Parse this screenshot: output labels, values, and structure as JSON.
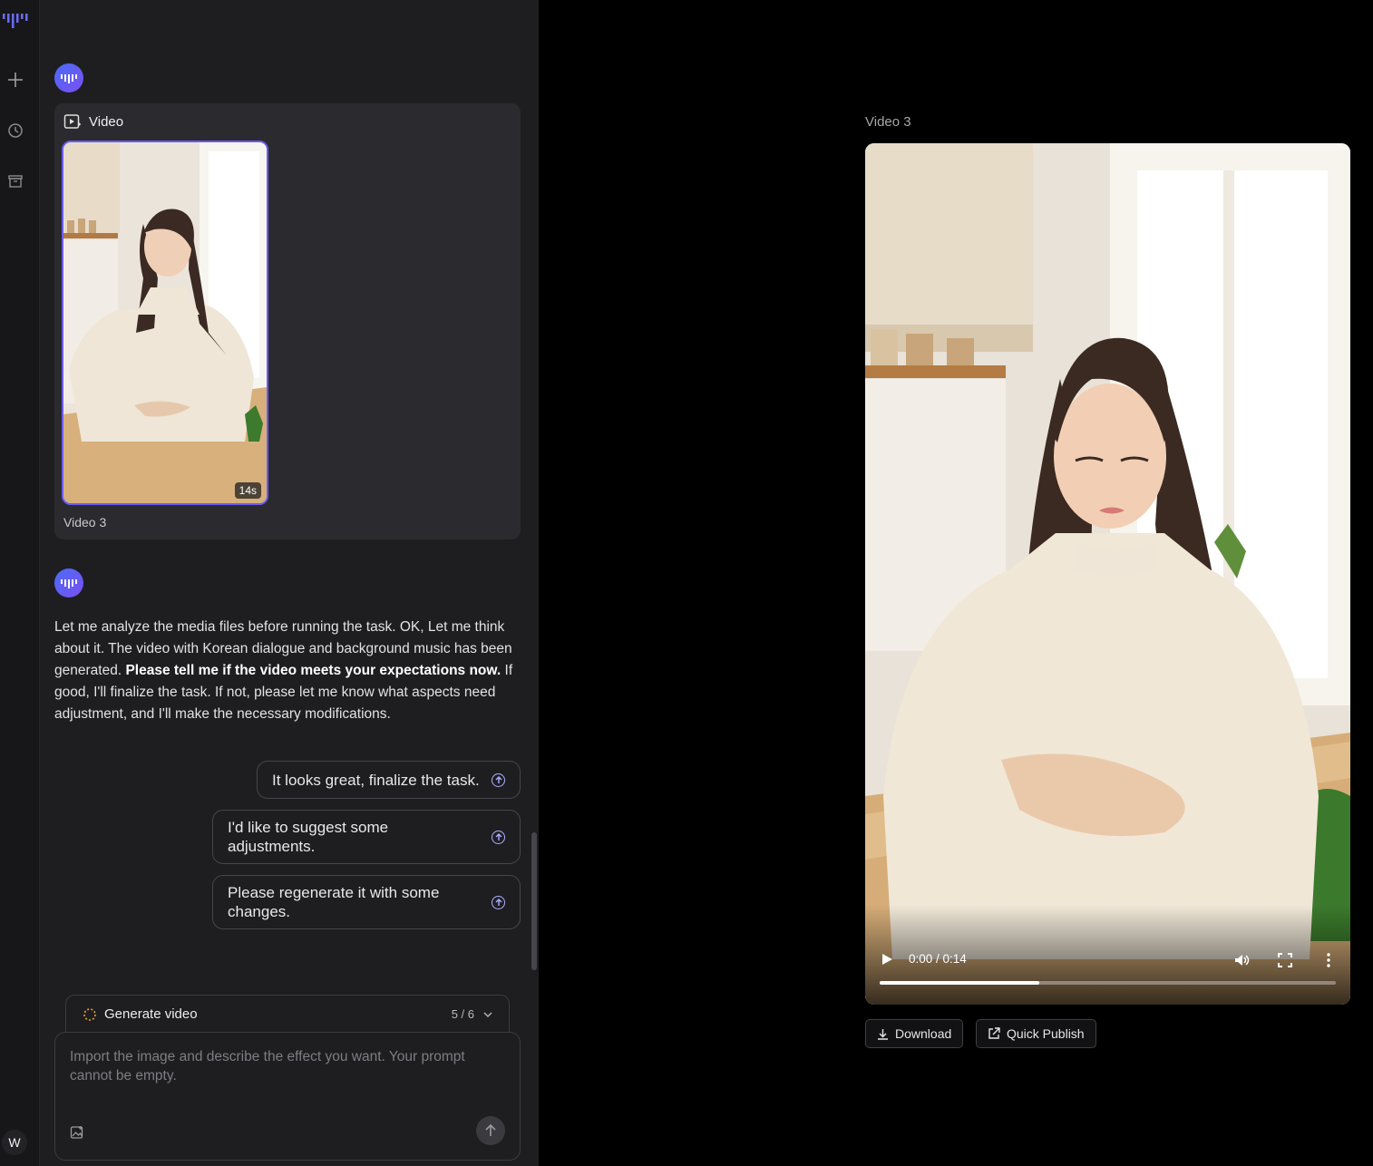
{
  "sidebar": {
    "logo": "brand-logo",
    "items": [
      {
        "name": "new-chat",
        "icon": "plus-icon"
      },
      {
        "name": "history",
        "icon": "history-icon"
      },
      {
        "name": "archive",
        "icon": "archive-icon"
      }
    ],
    "user_initial": "W"
  },
  "chat": {
    "video_card": {
      "header": "Video",
      "duration": "14s",
      "caption": "Video 3"
    },
    "reply": {
      "part1": "Let me analyze the media files before running the task. OK, Let me think about it. The video with Korean dialogue and background music has been generated. ",
      "bold": "Please tell me if the video meets your expectations now.",
      "part2": " If good, I'll finalize the task. If not, please let me know what aspects need adjustment, and I'll make the necessary modifications."
    },
    "suggestions": [
      "It looks great, finalize the task.",
      "I'd like to suggest some adjustments.",
      "Please regenerate it with some changes."
    ],
    "generator": {
      "label": "Generate video",
      "count": "5 / 6"
    },
    "input": {
      "placeholder": "Import the image and describe the effect you want. Your prompt cannot be empty."
    }
  },
  "preview": {
    "title": "Video 3",
    "player": {
      "time": "0:00 / 0:14",
      "progress": 0.35
    },
    "actions": {
      "download": "Download",
      "publish": "Quick Publish"
    }
  },
  "colors": {
    "accent": "#6b5cf6",
    "panel_bg": "#1e1e21",
    "card_bg": "#2b2b2f"
  }
}
